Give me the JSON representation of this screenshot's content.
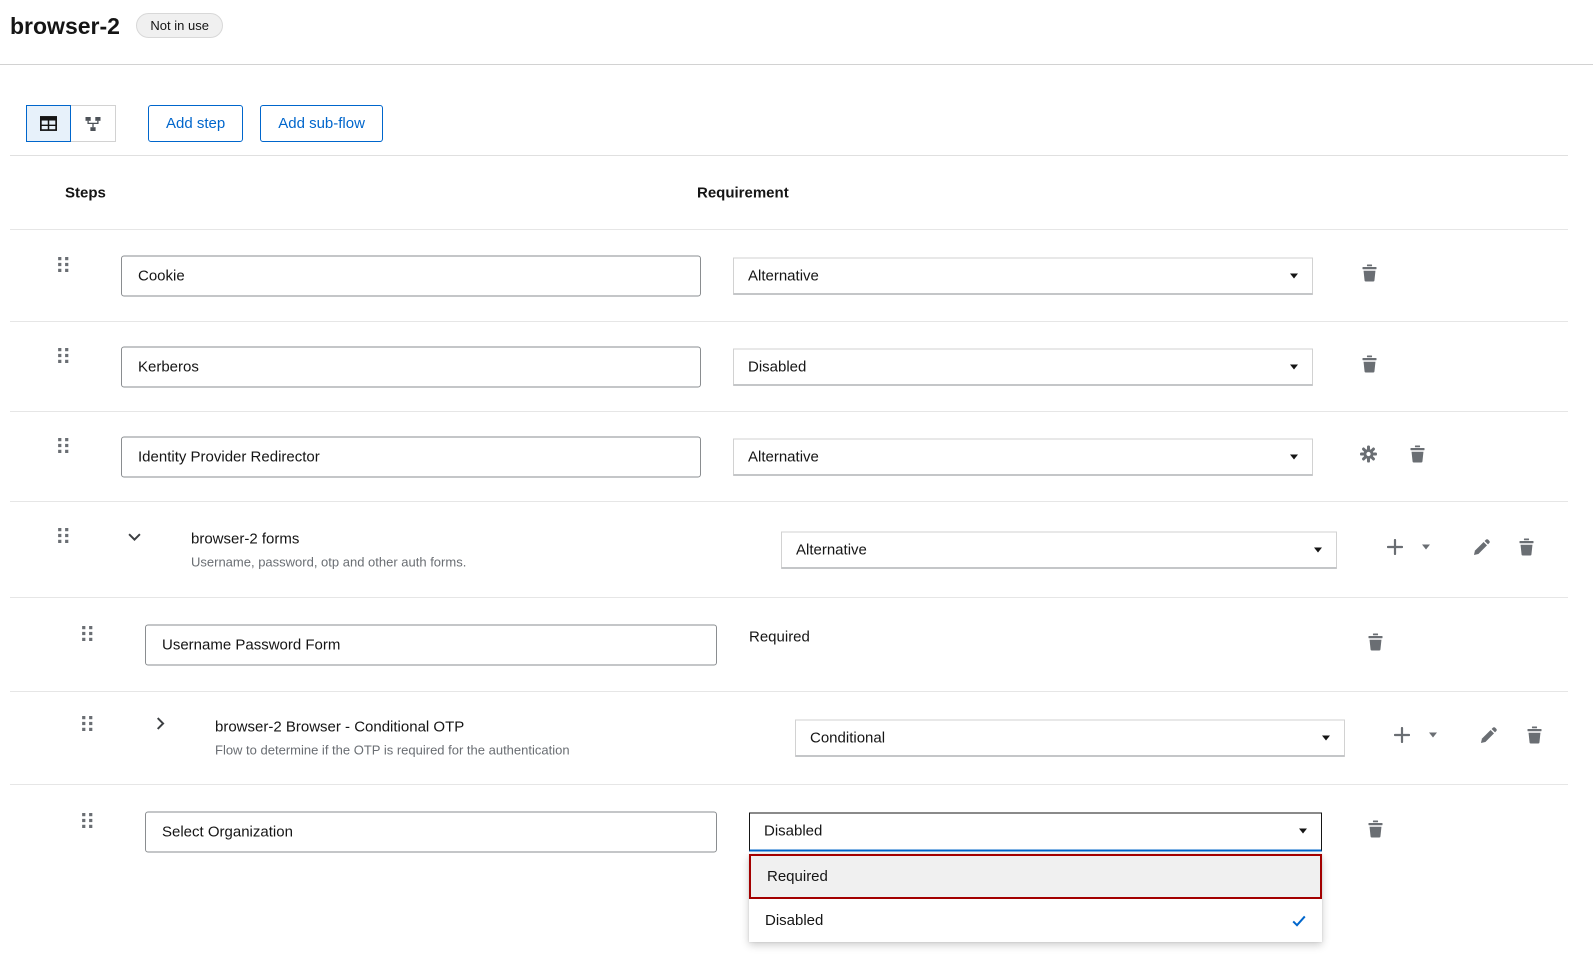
{
  "header": {
    "title": "browser-2",
    "badge": "Not in use"
  },
  "toolbar": {
    "add_step_label": "Add step",
    "add_sub_flow_label": "Add sub-flow",
    "view_toggle": {
      "selected": "table",
      "options": [
        "table",
        "diagram"
      ]
    }
  },
  "table": {
    "columns": {
      "steps": "Steps",
      "requirement": "Requirement"
    }
  },
  "rows": [
    {
      "type": "step",
      "level": 0,
      "name": "Cookie",
      "requirement": "Alternative",
      "actions": [
        "delete"
      ]
    },
    {
      "type": "step",
      "level": 0,
      "name": "Kerberos",
      "requirement": "Disabled",
      "actions": [
        "delete"
      ]
    },
    {
      "type": "step",
      "level": 0,
      "name": "Identity Provider Redirector",
      "requirement": "Alternative",
      "actions": [
        "settings",
        "delete"
      ]
    },
    {
      "type": "sub-flow",
      "level": 0,
      "expanded": true,
      "name": "browser-2 forms",
      "description": "Username, password, otp and other auth forms.",
      "requirement": "Alternative",
      "actions": [
        "add",
        "add-caret",
        "edit",
        "delete"
      ]
    },
    {
      "type": "step",
      "level": 1,
      "name": "Username Password Form",
      "requirement": "Required",
      "requirement_editable": false,
      "actions": [
        "delete"
      ]
    },
    {
      "type": "sub-flow",
      "level": 1,
      "expanded": false,
      "name": "browser-2 Browser - Conditional OTP",
      "description": "Flow to determine if the OTP is required for the authentication",
      "requirement": "Conditional",
      "actions": [
        "add",
        "add-caret",
        "edit",
        "delete"
      ]
    },
    {
      "type": "step",
      "level": 1,
      "name": "Select Organization",
      "requirement": "Disabled",
      "select_open": true,
      "actions": [
        "delete"
      ]
    }
  ],
  "requirement_menu": {
    "for_row": "Select Organization",
    "options": [
      {
        "label": "Required",
        "highlighted": true,
        "selected": false
      },
      {
        "label": "Disabled",
        "highlighted": false,
        "selected": true
      }
    ]
  },
  "icons": [
    "table-view-icon",
    "diagram-view-icon",
    "grip-vertical-icon",
    "chevron-down-icon",
    "chevron-right-icon",
    "caret-down-icon",
    "gear-icon",
    "trash-icon",
    "plus-icon",
    "pencil-icon",
    "check-icon"
  ],
  "colors": {
    "accent_blue": "#0066cc",
    "toggle_selected_bg": "#e7f1fa",
    "icon_gray": "#6a6e73",
    "text": "#151515",
    "muted_text": "#6a6e73",
    "divider": "#e0e0e0",
    "badge_bg": "#f0f0f0",
    "menu_highlight_bg": "#f0f0f0",
    "menu_highlight_border": "#a30000",
    "check_blue": "#0066cc"
  }
}
